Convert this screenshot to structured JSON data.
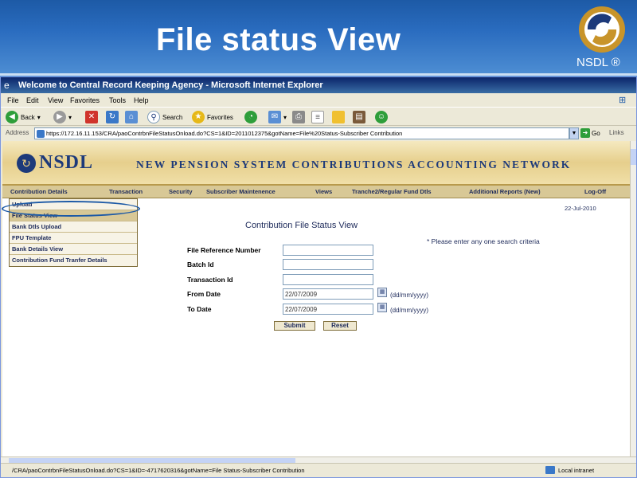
{
  "slide": {
    "title": "File status View",
    "logo_caption": "NSDL ®",
    "logo_icon": "nsdl-swirl-logo"
  },
  "browser": {
    "window_title": "Welcome to Central Record Keeping Agency - Microsoft Internet Explorer",
    "menu": [
      "File",
      "Edit",
      "View",
      "Favorites",
      "Tools",
      "Help"
    ],
    "toolbar": {
      "back": "Back",
      "search": "Search",
      "favorites": "Favorites"
    },
    "address": {
      "label": "Address",
      "url": "https://172.16.11.153/CRA/paoContrbnFileStatusOnload.do?CS=1&ID=2011012375&gotName=File%20Status-Subscriber Contribution",
      "go": "Go",
      "links": "Links"
    },
    "status": {
      "url": "/CRA/paoContrbnFileStatusOnload.do?CS=1&ID=-4717620316&gotName=File Status-Subscriber Contribution",
      "zone": "Local intranet"
    }
  },
  "site": {
    "logo": "NSDL",
    "banner_title": "NEW PENSION SYSTEM CONTRIBUTIONS ACCOUNTING NETWORK",
    "nav": [
      "Contribution Details",
      "Transaction",
      "Security",
      "Subscriber Maintenence",
      "Views",
      "Tranche2/Regular Fund Dtls",
      "Additional Reports (New)",
      "Log-Off"
    ],
    "dropdown": [
      "Upload",
      "File Status View",
      "Bank Dtls Upload",
      "FPU Template",
      "Bank Details View",
      "Contribution Fund Tranfer Details"
    ],
    "date_fragment": "22-Jul-2010"
  },
  "form": {
    "heading": "Contribution File Status View",
    "note": "* Please enter any one search criteria",
    "fields": {
      "file_ref": {
        "label": "File Reference Number",
        "value": ""
      },
      "batch_id": {
        "label": "Batch Id",
        "value": ""
      },
      "transaction_id": {
        "label": "Transaction Id",
        "value": ""
      },
      "from_date": {
        "label": "From Date",
        "value": "22/07/2009",
        "format": "(dd/mm/yyyy)"
      },
      "to_date": {
        "label": "To Date",
        "value": "22/07/2009",
        "format": "(dd/mm/yyyy)"
      }
    },
    "submit": "Submit",
    "reset": "Reset"
  }
}
